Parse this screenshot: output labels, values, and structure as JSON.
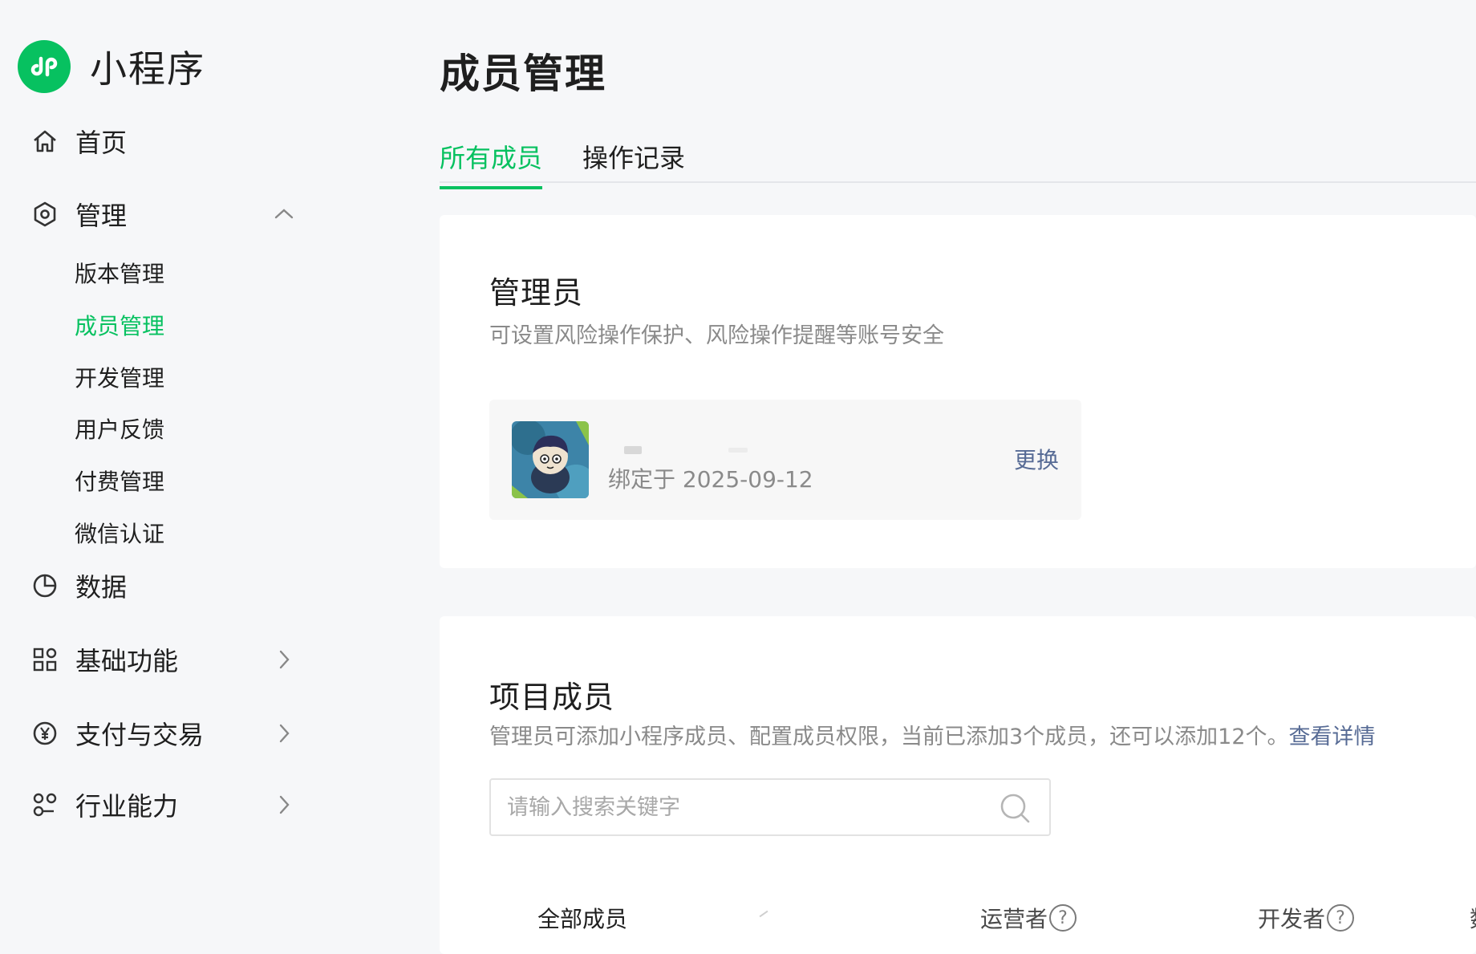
{
  "brand": {
    "name": "小程序",
    "logo_icon": "miniprogram-logo-icon",
    "accent": "#07c160"
  },
  "sidebar": {
    "home": {
      "label": "首页",
      "icon": "home-icon"
    },
    "manage": {
      "label": "管理",
      "icon": "hexagon-gear-icon",
      "expanded": true,
      "items": [
        {
          "label": "版本管理",
          "active": false
        },
        {
          "label": "成员管理",
          "active": true
        },
        {
          "label": "开发管理",
          "active": false
        },
        {
          "label": "用户反馈",
          "active": false
        },
        {
          "label": "付费管理",
          "active": false
        },
        {
          "label": "微信认证",
          "active": false
        }
      ]
    },
    "data": {
      "label": "数据",
      "icon": "pie-chart-icon"
    },
    "basic": {
      "label": "基础功能",
      "icon": "grid-icon"
    },
    "pay": {
      "label": "支付与交易",
      "icon": "yen-circle-icon"
    },
    "industry": {
      "label": "行业能力",
      "icon": "nodes-icon"
    }
  },
  "page": {
    "title": "成员管理",
    "tabs": [
      {
        "label": "所有成员",
        "active": true
      },
      {
        "label": "操作记录",
        "active": false
      }
    ]
  },
  "admin_card": {
    "title": "管理员",
    "description": "可设置风险操作保护、风险操作提醒等账号安全",
    "bind_date": "绑定于 2025-09-12",
    "change_label": "更换"
  },
  "members_card": {
    "title": "项目成员",
    "description": "管理员可添加小程序成员、配置成员权限，当前已添加3个成员，还可以添加12个。",
    "detail_link": "查看详情",
    "search_placeholder": "请输入搜索关键字",
    "filters": [
      {
        "label": "全部成员",
        "active": true,
        "help": false
      },
      {
        "label": "运营者",
        "active": false,
        "help": true
      },
      {
        "label": "开发者",
        "active": false,
        "help": true
      },
      {
        "label": "数",
        "active": false,
        "help": false
      }
    ],
    "help_glyph": "?"
  },
  "colors": {
    "link": "#576b95",
    "muted": "#8a8a8a",
    "background": "#f6f7f9"
  }
}
